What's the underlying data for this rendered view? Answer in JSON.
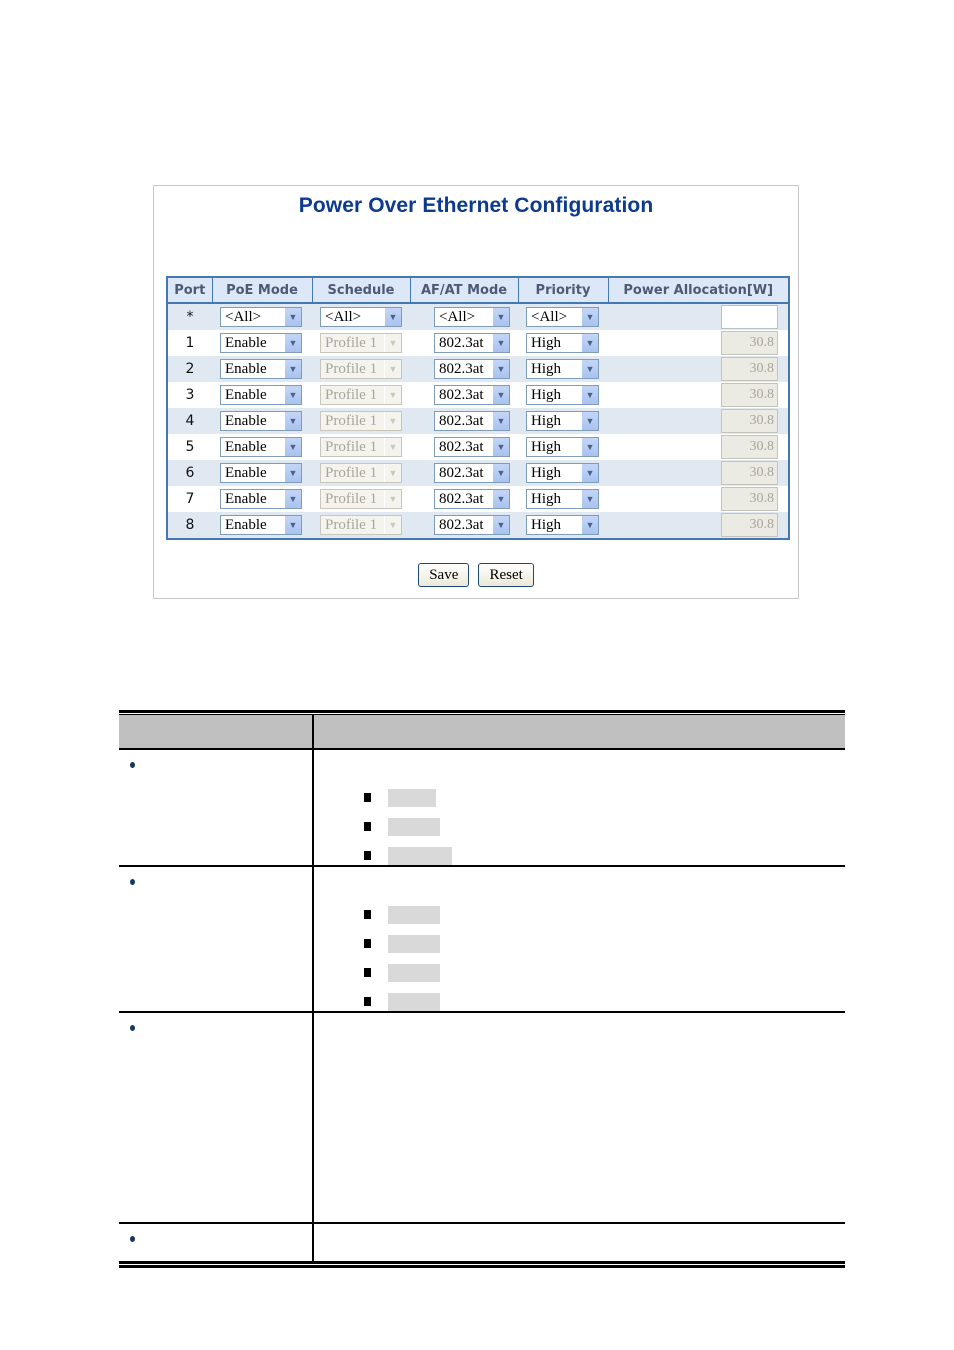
{
  "screenshot": {
    "title": "Power Over Ethernet Configuration",
    "table": {
      "headers": [
        "Port",
        "PoE Mode",
        "Schedule",
        "AF/AT Mode",
        "Priority",
        "Power Allocation[W]"
      ],
      "all_row": {
        "port": "*",
        "poe_mode": "<All>",
        "schedule": "<All>",
        "af_at_mode": "<All>",
        "priority": "<All>",
        "power_allocation": ""
      },
      "rows": [
        {
          "port": "1",
          "poe_mode": "Enable",
          "schedule": "Profile 1",
          "af_at_mode": "802.3at",
          "priority": "High",
          "power_allocation": "30.8"
        },
        {
          "port": "2",
          "poe_mode": "Enable",
          "schedule": "Profile 1",
          "af_at_mode": "802.3at",
          "priority": "High",
          "power_allocation": "30.8"
        },
        {
          "port": "3",
          "poe_mode": "Enable",
          "schedule": "Profile 1",
          "af_at_mode": "802.3at",
          "priority": "High",
          "power_allocation": "30.8"
        },
        {
          "port": "4",
          "poe_mode": "Enable",
          "schedule": "Profile 1",
          "af_at_mode": "802.3at",
          "priority": "High",
          "power_allocation": "30.8"
        },
        {
          "port": "5",
          "poe_mode": "Enable",
          "schedule": "Profile 1",
          "af_at_mode": "802.3at",
          "priority": "High",
          "power_allocation": "30.8"
        },
        {
          "port": "6",
          "poe_mode": "Enable",
          "schedule": "Profile 1",
          "af_at_mode": "802.3at",
          "priority": "High",
          "power_allocation": "30.8"
        },
        {
          "port": "7",
          "poe_mode": "Enable",
          "schedule": "Profile 1",
          "af_at_mode": "802.3at",
          "priority": "High",
          "power_allocation": "30.8"
        },
        {
          "port": "8",
          "poe_mode": "Enable",
          "schedule": "Profile 1",
          "af_at_mode": "802.3at",
          "priority": "High",
          "power_allocation": "30.8"
        }
      ]
    },
    "buttons": {
      "save": "Save",
      "reset": "Reset"
    },
    "colors": {
      "title": "#0b3a8f",
      "table_border": "#4577b1",
      "header_bg": "#dce8f7",
      "odd_row_bg": "#e0e8f2"
    }
  },
  "doc_table": {
    "rows": [
      {
        "bullet": true,
        "sub_items": 3
      },
      {
        "bullet": true,
        "sub_items": 4
      },
      {
        "bullet": true,
        "sub_items": 0
      },
      {
        "bullet": true,
        "sub_items": 0
      }
    ],
    "colors": {
      "header_bg": "#c0c0c0",
      "highlight": "#d9d9d9",
      "bullet": "#17375e"
    }
  }
}
